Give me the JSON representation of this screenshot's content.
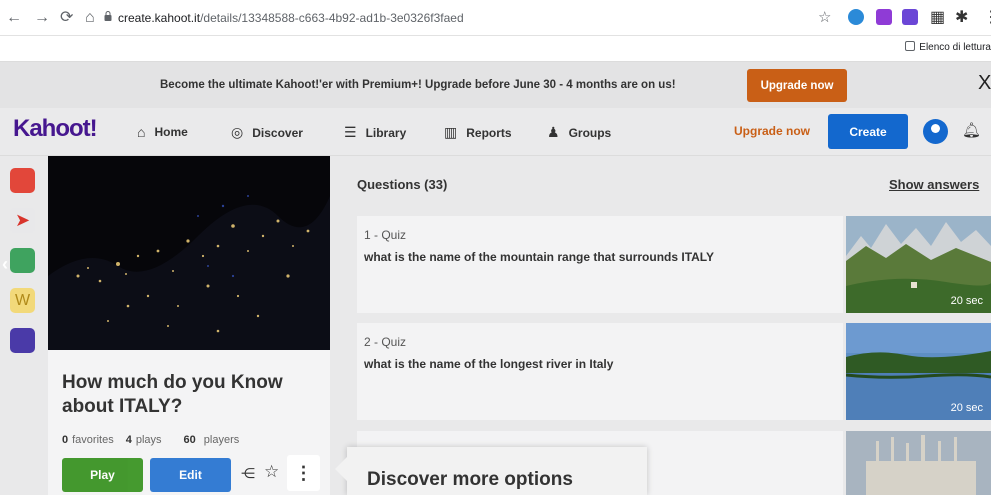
{
  "browser": {
    "url_host": "create.kahoot.it",
    "url_path": "/details/13348588-c663-4b92-ad1b-3e0326f3faed",
    "reading_list": "Elenco di lettura",
    "icons": [
      "back-icon",
      "forward-icon",
      "reload-icon",
      "home-icon",
      "lock-icon",
      "star-icon",
      "extension-icons",
      "puzzle-icon",
      "menu-icon"
    ]
  },
  "promo": {
    "text": "Become the ultimate Kahoot!'er with Premium+! Upgrade before June 30 - 4 months are on us!",
    "button": "Upgrade now",
    "close": "X"
  },
  "nav": {
    "logo": "Kahoot!",
    "items": [
      {
        "label": "Home",
        "icon": "⌂"
      },
      {
        "label": "Discover",
        "icon": "◎"
      },
      {
        "label": "Library",
        "icon": "☰"
      },
      {
        "label": "Reports",
        "icon": "▥"
      },
      {
        "label": "Groups",
        "icon": "♟"
      }
    ],
    "upgrade": "Upgrade now",
    "create": "Create"
  },
  "kahoot": {
    "title": "How much do you Know about ITALY?",
    "favorites_count": "0",
    "favorites_label": "favorites",
    "plays_count": "4",
    "plays_label": "plays",
    "players_count": "60",
    "players_label": "players",
    "play": "Play",
    "edit": "Edit"
  },
  "tooltip": "Discover more options",
  "questions": {
    "header": "Questions (33)",
    "show_answers": "Show answers",
    "items": [
      {
        "type": "1 - Quiz",
        "text": "what is the name of the mountain range that surrounds ITALY",
        "time": "20 sec"
      },
      {
        "type": "2 - Quiz",
        "text": "what is the name of the longest river in Italy",
        "time": "20 sec"
      }
    ]
  },
  "colors": {
    "brand_purple": "#46178f",
    "primary_blue": "#1368ce",
    "upgrade_orange": "#c95f16",
    "play_green": "#26890c"
  }
}
